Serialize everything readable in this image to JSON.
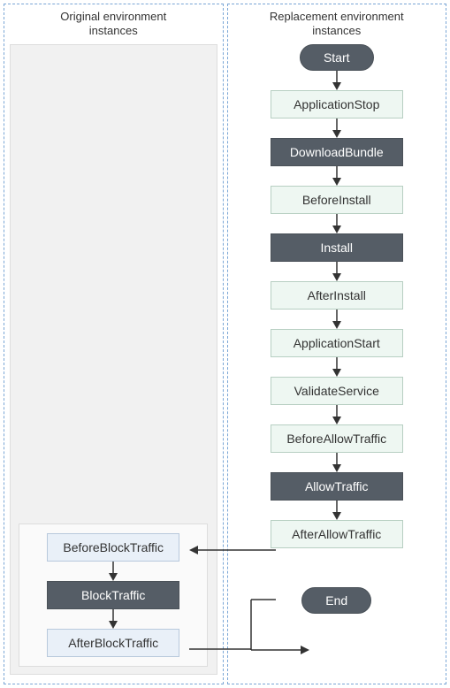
{
  "columns": {
    "left": {
      "title_line1": "Original environment",
      "title_line2": "instances"
    },
    "right": {
      "title_line1": "Replacement environment",
      "title_line2": "instances"
    }
  },
  "terminals": {
    "start": "Start",
    "end": "End"
  },
  "right_nodes": [
    {
      "label": "ApplicationStop",
      "style": "green"
    },
    {
      "label": "DownloadBundle",
      "style": "dark"
    },
    {
      "label": "BeforeInstall",
      "style": "green"
    },
    {
      "label": "Install",
      "style": "dark"
    },
    {
      "label": "AfterInstall",
      "style": "green"
    },
    {
      "label": "ApplicationStart",
      "style": "green"
    },
    {
      "label": "ValidateService",
      "style": "green"
    },
    {
      "label": "BeforeAllowTraffic",
      "style": "green"
    },
    {
      "label": "AllowTraffic",
      "style": "dark"
    },
    {
      "label": "AfterAllowTraffic",
      "style": "green"
    }
  ],
  "left_nodes": [
    {
      "label": "BeforeBlockTraffic",
      "style": "blue"
    },
    {
      "label": "BlockTraffic",
      "style": "dark"
    },
    {
      "label": "AfterBlockTraffic",
      "style": "blue"
    }
  ]
}
